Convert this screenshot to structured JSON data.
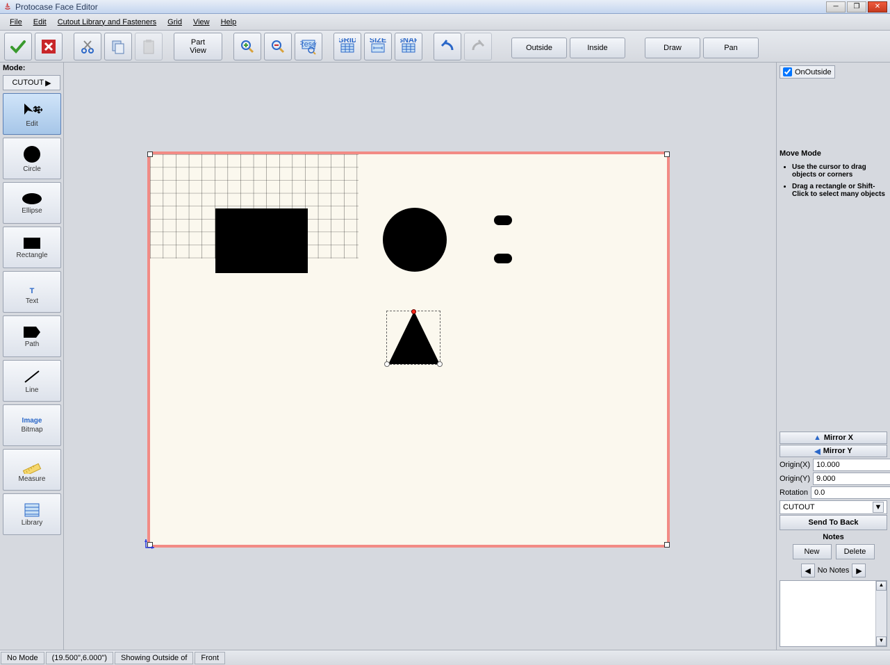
{
  "window": {
    "title": "Protocase Face Editor"
  },
  "menu": [
    "File",
    "Edit",
    "Cutout Library and Fasteners",
    "Grid",
    "View",
    "Help"
  ],
  "toolbar": {
    "part_view": "Part\nView",
    "outside": "Outside",
    "inside": "Inside",
    "draw": "Draw",
    "pan": "Pan"
  },
  "left": {
    "mode_label": "Mode:",
    "mode_value": "CUTOUT",
    "tools": [
      {
        "id": "edit",
        "label": "Edit"
      },
      {
        "id": "circle",
        "label": "Circle"
      },
      {
        "id": "ellipse",
        "label": "Ellipse"
      },
      {
        "id": "rectangle",
        "label": "Rectangle"
      },
      {
        "id": "text",
        "label": "Text"
      },
      {
        "id": "path",
        "label": "Path"
      },
      {
        "id": "line",
        "label": "Line"
      },
      {
        "id": "bitmap",
        "label": "Bitmap",
        "aux": "Image"
      },
      {
        "id": "measure",
        "label": "Measure"
      },
      {
        "id": "library",
        "label": "Library"
      }
    ]
  },
  "right": {
    "on_outside": "OnOutside",
    "hint_title": "Move Mode",
    "hints": [
      "Use the cursor to drag objects or corners",
      "Drag a rectangle or Shift-Click to select many objects"
    ],
    "mirror_x": "Mirror X",
    "mirror_y": "Mirror Y",
    "origin_x_label": "Origin(X)",
    "origin_x": "10.000",
    "origin_y_label": "Origin(Y)",
    "origin_y": "9.000",
    "rotation_label": "Rotation",
    "rotation": "0.0",
    "layer": "CUTOUT",
    "send_back": "Send To Back",
    "notes_title": "Notes",
    "new": "New",
    "delete": "Delete",
    "no_notes": "No Notes"
  },
  "status": {
    "mode": "No Mode",
    "coords": "(19.500\",6.000\")",
    "showing": "Showing Outside of",
    "face": "Front"
  }
}
